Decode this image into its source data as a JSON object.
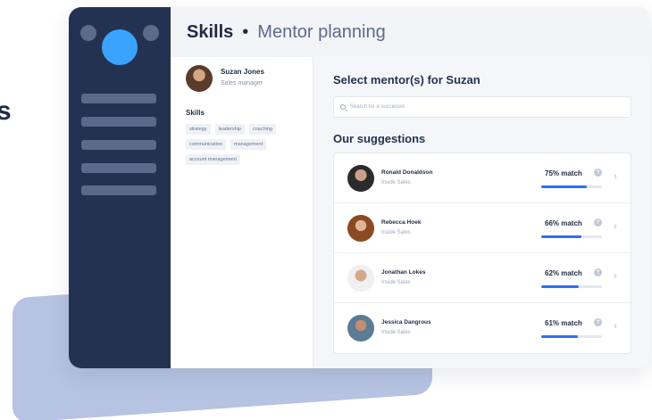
{
  "partial_text": {
    "glyph": "s"
  },
  "header": {
    "section": "Skills",
    "separator": "•",
    "page": "Mentor planning"
  },
  "profile": {
    "name": "Suzan Jones",
    "role": "Sales manager"
  },
  "skills": {
    "title": "Skills",
    "chips": [
      "strategy",
      "leadership",
      "coaching",
      "communication",
      "management",
      "account management"
    ]
  },
  "main": {
    "title": "Select mentor(s) for Suzan",
    "search_placeholder": "Search for a successor",
    "suggestions_title": "Our suggestions"
  },
  "suggestions": [
    {
      "name": "Ronald Donaldson",
      "team": "Inside Sales",
      "match_label": "75% match",
      "match": 0.75
    },
    {
      "name": "Rebecca Hoek",
      "team": "Inside Sales",
      "match_label": "66% match",
      "match": 0.66
    },
    {
      "name": "Jonathan Lokes",
      "team": "Inside Sales",
      "match_label": "62% match",
      "match": 0.62
    },
    {
      "name": "Jessica Dangrous",
      "team": "Inside Sales",
      "match_label": "61% match",
      "match": 0.61
    }
  ],
  "colors": {
    "sidebar": "#243252",
    "accent": "#2d6ff2",
    "avatar": "#3aa3ff",
    "backdrop": "#b6c3e2"
  },
  "icons": {
    "search": "search-icon",
    "info": "info-icon",
    "chevron": "chevron-right-icon"
  }
}
